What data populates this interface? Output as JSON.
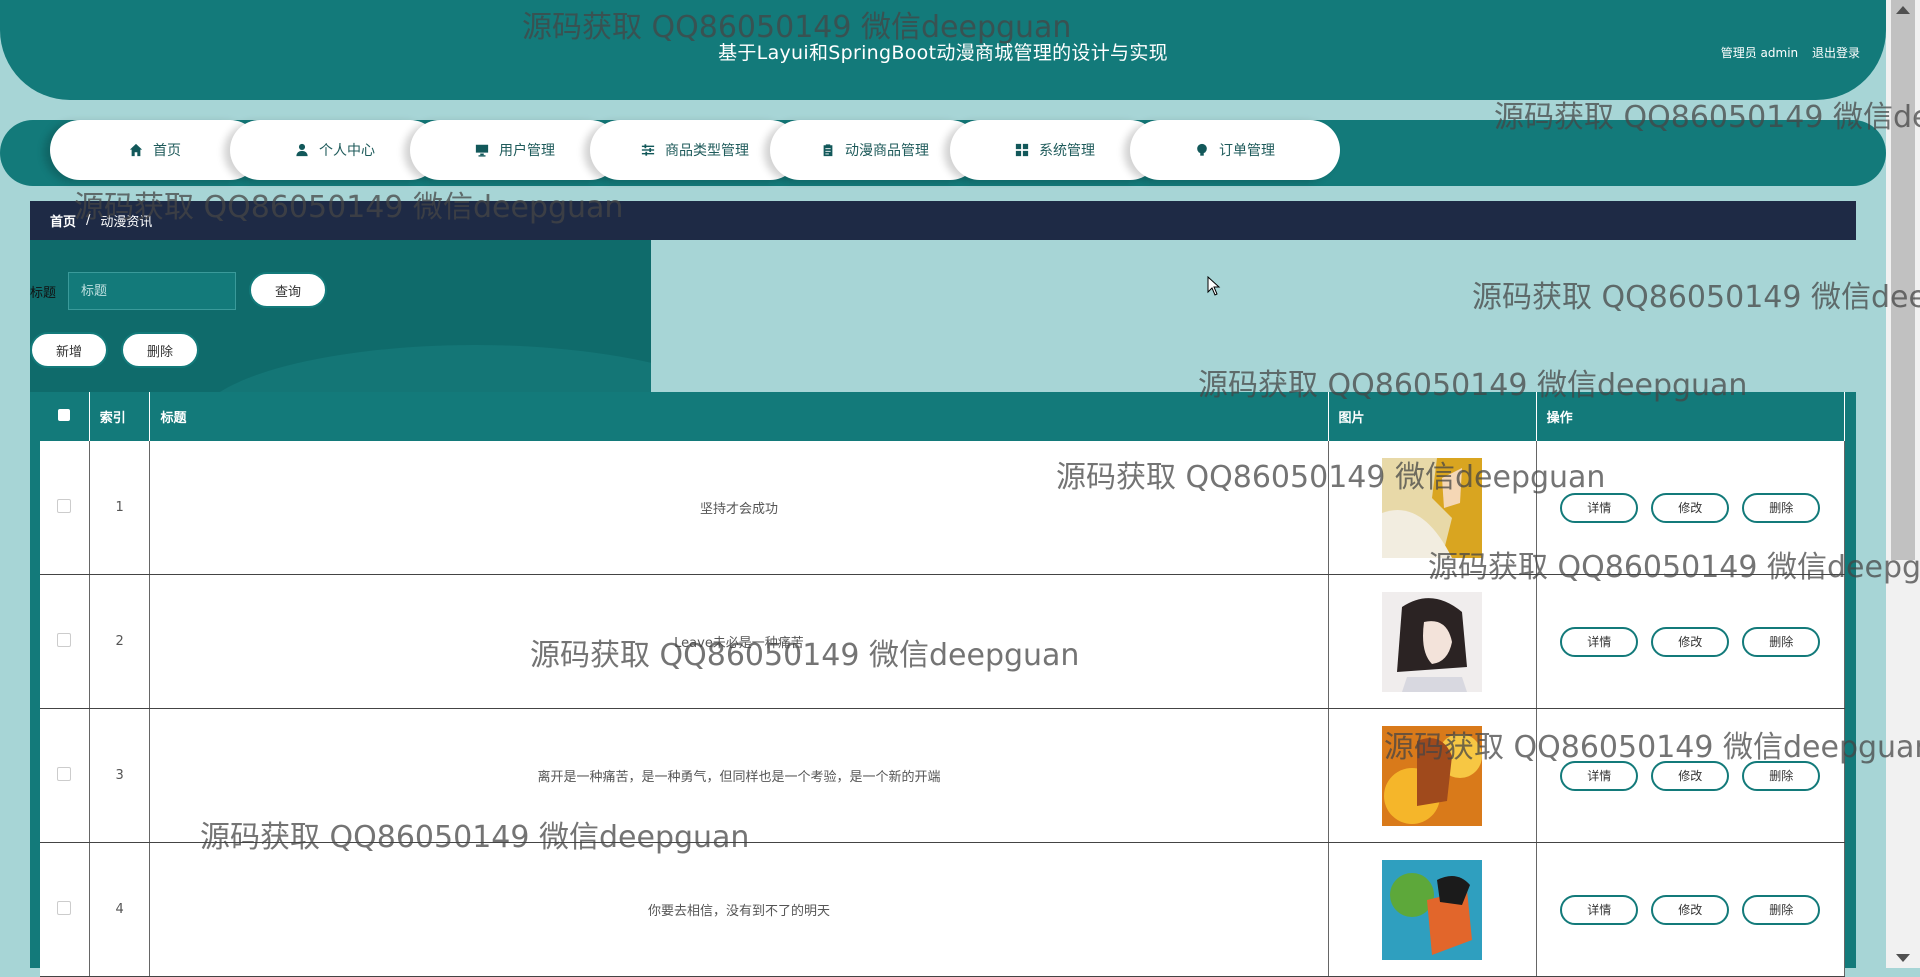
{
  "header": {
    "title": "基于Layui和SpringBoot动漫商城管理的设计与实现",
    "user_label": "管理员 admin",
    "logout_label": "退出登录"
  },
  "nav": {
    "items": [
      {
        "label": "首页",
        "icon": "home-icon"
      },
      {
        "label": "个人中心",
        "icon": "user-icon"
      },
      {
        "label": "用户管理",
        "icon": "monitor-icon"
      },
      {
        "label": "商品类型管理",
        "icon": "sliders-icon"
      },
      {
        "label": "动漫商品管理",
        "icon": "clipboard-icon"
      },
      {
        "label": "系统管理",
        "icon": "grid-icon"
      },
      {
        "label": "订单管理",
        "icon": "bulb-icon"
      }
    ]
  },
  "breadcrumb": {
    "home": "首页",
    "separator": "/",
    "current": "动漫资讯"
  },
  "search": {
    "label": "标题",
    "placeholder": "标题",
    "button": "查询"
  },
  "actions": {
    "add": "新增",
    "delete": "删除"
  },
  "table": {
    "headers": {
      "index": "索引",
      "title": "标题",
      "image": "图片",
      "operation": "操作"
    },
    "rows": [
      {
        "index": "1",
        "title": "坚持才会成功"
      },
      {
        "index": "2",
        "title": "Leave未必是一种痛苦"
      },
      {
        "index": "3",
        "title": "离开是一种痛苦，是一种勇气，但同样也是一个考验，是一个新的开端"
      },
      {
        "index": "4",
        "title": "你要去相信，没有到不了的明天"
      }
    ],
    "row_buttons": {
      "detail": "详情",
      "edit": "修改",
      "delete": "删除"
    }
  },
  "watermark": "源码获取 QQ86050149 微信deepguan",
  "colors": {
    "primary": "#137a7a",
    "page_bg": "#a7d5d6",
    "breadcrumb_bg": "#1e2a45"
  }
}
